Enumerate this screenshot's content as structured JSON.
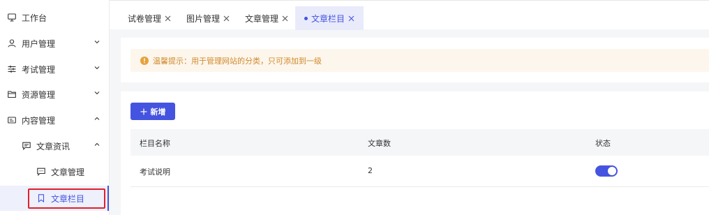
{
  "sidebar": {
    "items": [
      {
        "label": "工作台",
        "icon": "monitor-icon"
      },
      {
        "label": "用户管理",
        "icon": "user-icon",
        "chevron": "down"
      },
      {
        "label": "考试管理",
        "icon": "sliders-icon",
        "chevron": "down"
      },
      {
        "label": "资源管理",
        "icon": "folder-icon",
        "chevron": "down"
      },
      {
        "label": "内容管理",
        "icon": "id-card-icon",
        "chevron": "up"
      },
      {
        "label": "文章资讯",
        "icon": "message-icon",
        "chevron": "up"
      },
      {
        "label": "文章管理",
        "icon": "chat-icon"
      },
      {
        "label": "文章栏目",
        "icon": "bookmark-icon",
        "active": true
      }
    ]
  },
  "tabs": [
    {
      "label": "试卷管理"
    },
    {
      "label": "图片管理"
    },
    {
      "label": "文章管理"
    },
    {
      "label": "文章栏目",
      "active": true
    }
  ],
  "notice": {
    "text": "温馨提示：用于管理网站的分类，只可添加到一级"
  },
  "toolbar": {
    "add_label": "新增"
  },
  "table": {
    "columns": [
      "栏目名称",
      "文章数",
      "状态"
    ],
    "rows": [
      {
        "name": "考试说明",
        "count": "2",
        "status_on": true
      }
    ]
  },
  "colors": {
    "accent": "#4454e0",
    "warning_text": "#d08a2c",
    "warning_bg": "#fdf6ec",
    "highlight": "#e0202e"
  }
}
